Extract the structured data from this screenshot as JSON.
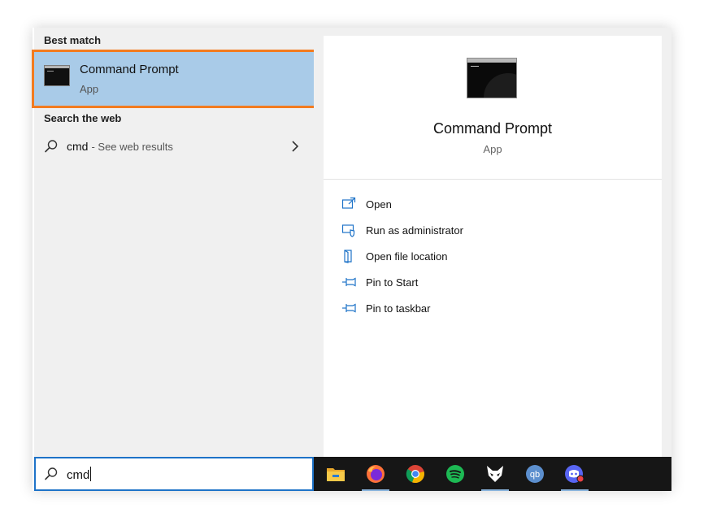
{
  "left": {
    "best_match_label": "Best match",
    "best_match": {
      "title": "Command Prompt",
      "subtitle": "App",
      "icon": "command-prompt-icon"
    },
    "web_label": "Search the web",
    "web_result": {
      "query": "cmd",
      "suffix": "- See web results",
      "icon": "search-icon"
    }
  },
  "detail": {
    "title": "Command Prompt",
    "subtitle": "App",
    "actions": [
      {
        "label": "Open",
        "icon": "open-icon"
      },
      {
        "label": "Run as administrator",
        "icon": "run-as-admin-icon"
      },
      {
        "label": "Open file location",
        "icon": "file-location-icon"
      },
      {
        "label": "Pin to Start",
        "icon": "pin-icon"
      },
      {
        "label": "Pin to taskbar",
        "icon": "pin-icon"
      }
    ]
  },
  "search": {
    "value": "cmd"
  },
  "taskbar": {
    "apps": [
      {
        "name": "File Explorer",
        "icon": "file-explorer-icon",
        "running": false
      },
      {
        "name": "Firefox",
        "icon": "firefox-icon",
        "running": true
      },
      {
        "name": "Chrome",
        "icon": "chrome-icon",
        "running": false
      },
      {
        "name": "Spotify",
        "icon": "spotify-icon",
        "running": false
      },
      {
        "name": "Foxit",
        "icon": "fox-icon",
        "running": true
      },
      {
        "name": "qBittorrent",
        "icon": "qbittorrent-icon",
        "running": false
      },
      {
        "name": "Discord",
        "icon": "discord-icon",
        "running": true
      }
    ]
  },
  "colors": {
    "accent": "#1e73c8",
    "highlight": "#a9cbe8",
    "focus_ring": "#f37b1f",
    "taskbar_bg": "#161616",
    "pane_bg": "#f0f0f0"
  }
}
